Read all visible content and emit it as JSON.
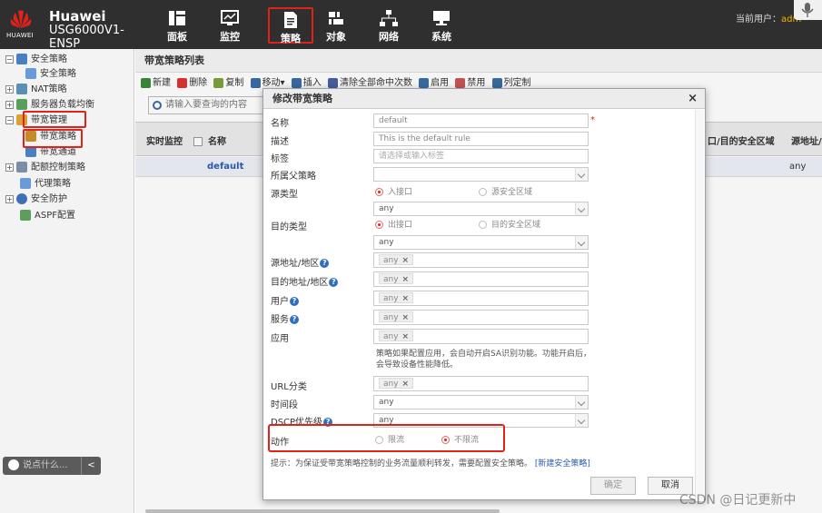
{
  "header": {
    "brand_logo_text": "HUAWEI",
    "brand_name": "Huawei",
    "brand_model": "USG6000V1-ENSP",
    "nav": [
      {
        "label": "面板"
      },
      {
        "label": "监控"
      },
      {
        "label": "策略"
      },
      {
        "label": "对象"
      },
      {
        "label": "网络"
      },
      {
        "label": "系统"
      }
    ],
    "user_label": "当前用户：",
    "user_name": "adm"
  },
  "sidebar": {
    "items": [
      {
        "label": "安全策略",
        "toggle": "−"
      },
      {
        "label": "安全策略"
      },
      {
        "label": "NAT策略",
        "toggle": "+"
      },
      {
        "label": "服务器负载均衡",
        "toggle": "+"
      },
      {
        "label": "带宽管理",
        "toggle": "−"
      },
      {
        "label": "带宽策略"
      },
      {
        "label": "带宽通道"
      },
      {
        "label": "配额控制策略",
        "toggle": "+"
      },
      {
        "label": "代理策略"
      },
      {
        "label": "安全防护",
        "toggle": "+"
      },
      {
        "label": "ASPF配置"
      }
    ],
    "chat_placeholder": "说点什么...",
    "collapse_icon": "<"
  },
  "main": {
    "title": "带宽策略列表",
    "toolbar": [
      "新建",
      "删除",
      "复制",
      "移动▾",
      "插入",
      "清除全部命中次数",
      "启用",
      "禁用",
      "列定制"
    ],
    "search_placeholder": "请输入要查询的内容",
    "columns": [
      "实时监控",
      "名称",
      "口/目的安全区域",
      "源地址/地"
    ],
    "rows": [
      {
        "name": "default",
        "src_addr": "any"
      }
    ]
  },
  "modal": {
    "title": "修改带宽策略",
    "close": "×",
    "fields": {
      "name_label": "名称",
      "name_value": "default",
      "desc_label": "描述",
      "desc_value": "This is the default rule",
      "tag_label": "标签",
      "tag_placeholder": "请选择或输入标签",
      "parent_label": "所属父策略",
      "src_type_label": "源类型",
      "src_type_opt1": "入接口",
      "src_type_opt2": "源安全区域",
      "src_type_value": "any",
      "dst_type_label": "目的类型",
      "dst_type_opt1": "出接口",
      "dst_type_opt2": "目的安全区域",
      "dst_type_value": "any",
      "src_addr_label": "源地址/地区",
      "dst_addr_label": "目的地址/地区",
      "user_label": "用户",
      "service_label": "服务",
      "app_label": "应用",
      "any_tag": "any",
      "any_x": "×",
      "app_note": "策略如果配置应用，会自动开启SA识别功能。功能开启后，会导致设备性能降低。",
      "url_label": "URL分类",
      "time_label": "时间段",
      "time_value": "any",
      "dscp_label": "DSCP优先级",
      "dscp_value": "any",
      "action_label": "动作",
      "action_opt1": "限流",
      "action_opt2": "不限流",
      "required_mark": "*",
      "help_mark": "?"
    },
    "tip_text": "提示：为保证受带宽策略控制的业务流量顺利转发，需要配置安全策略。",
    "tip_link": "[新建安全策略]",
    "ok_button": "确定",
    "cancel_button": "取消"
  },
  "watermark": "CSDN @日记更新中",
  "colors": {
    "header_bg": "#2f2f2f",
    "highlight_red": "#e0221b",
    "link_blue": "#2a5db0"
  }
}
